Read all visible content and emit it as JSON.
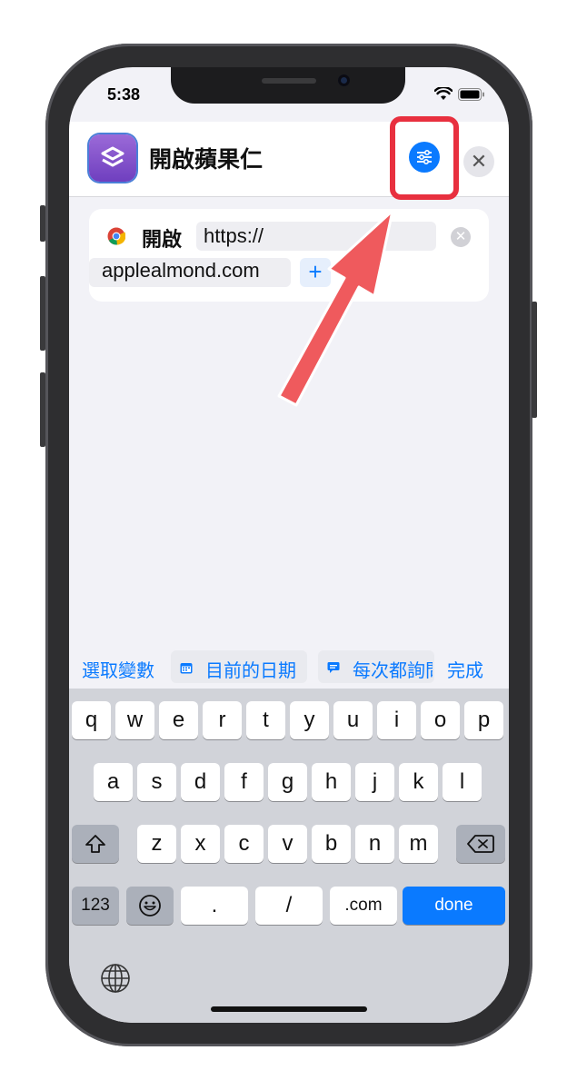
{
  "status": {
    "time": "5:38"
  },
  "header": {
    "title": "開啟蘋果仁"
  },
  "action": {
    "verb": "開啟",
    "url_part1": "https://",
    "url_part2": "applealmond.com"
  },
  "variable_bar": {
    "select_variable": "選取變數",
    "current_date": "目前的日期",
    "ask_each_time": "每次都詢問",
    "done": "完成"
  },
  "keyboard": {
    "row1": [
      "q",
      "w",
      "e",
      "r",
      "t",
      "y",
      "u",
      "i",
      "o",
      "p"
    ],
    "row2": [
      "a",
      "s",
      "d",
      "f",
      "g",
      "h",
      "j",
      "k",
      "l"
    ],
    "row3": [
      "z",
      "x",
      "c",
      "v",
      "b",
      "n",
      "m"
    ],
    "num_label": "123",
    "dot": ".",
    "slash": "/",
    "dotcom": ".com",
    "done": "done"
  },
  "colors": {
    "accent": "#0a7aff",
    "highlight": "#e8303f"
  }
}
